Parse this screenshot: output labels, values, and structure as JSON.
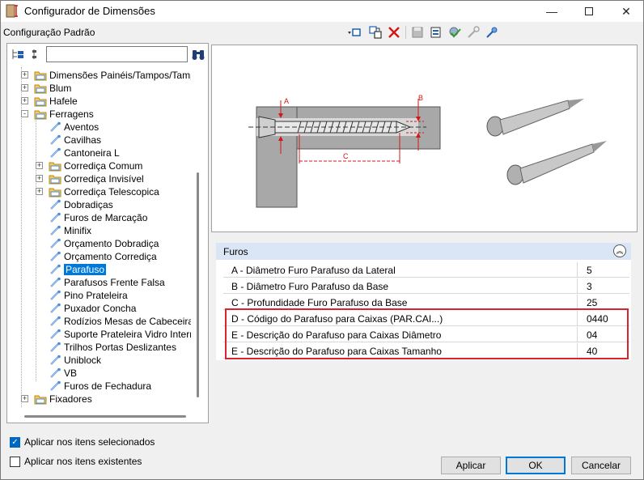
{
  "window": {
    "title": "Configurador de Dimensões"
  },
  "config_label": "Configuração Padrão",
  "toolbar_icons": [
    "fit-window-icon",
    "copy-icon",
    "delete-icon",
    "save-icon",
    "export-icon",
    "check-gear-icon",
    "link-icon",
    "pin-icon"
  ],
  "search": {
    "value": "",
    "placeholder": ""
  },
  "tree": [
    {
      "label": "Dimensões Painéis/Tampos/Tamponamentos",
      "level": 1,
      "type": "folder",
      "expander": "+"
    },
    {
      "label": "Blum",
      "level": 1,
      "type": "folder",
      "expander": "+"
    },
    {
      "label": "Hafele",
      "level": 1,
      "type": "folder",
      "expander": "+"
    },
    {
      "label": "Ferragens",
      "level": 1,
      "type": "folder",
      "expander": "-"
    },
    {
      "label": "Aventos",
      "level": 2,
      "type": "item"
    },
    {
      "label": "Cavilhas",
      "level": 2,
      "type": "item"
    },
    {
      "label": "Cantoneira L",
      "level": 2,
      "type": "item"
    },
    {
      "label": "Corrediça Comum",
      "level": 2,
      "type": "folder",
      "expander": "+"
    },
    {
      "label": "Corrediça Invisível",
      "level": 2,
      "type": "folder",
      "expander": "+"
    },
    {
      "label": "Corrediça Telescopica",
      "level": 2,
      "type": "folder",
      "expander": "+"
    },
    {
      "label": "Dobradiças",
      "level": 2,
      "type": "item"
    },
    {
      "label": "Furos de Marcação",
      "level": 2,
      "type": "item"
    },
    {
      "label": "Minifix",
      "level": 2,
      "type": "item"
    },
    {
      "label": "Orçamento Dobradiça",
      "level": 2,
      "type": "item"
    },
    {
      "label": "Orçamento Corrediça",
      "level": 2,
      "type": "item"
    },
    {
      "label": "Parafuso",
      "level": 2,
      "type": "item",
      "selected": true
    },
    {
      "label": "Parafusos Frente Falsa",
      "level": 2,
      "type": "item"
    },
    {
      "label": "Pino Prateleira",
      "level": 2,
      "type": "item"
    },
    {
      "label": "Puxador Concha",
      "level": 2,
      "type": "item"
    },
    {
      "label": "Rodízios Mesas de Cabeceira",
      "level": 2,
      "type": "item"
    },
    {
      "label": "Suporte Prateleira Vidro Interno",
      "level": 2,
      "type": "item"
    },
    {
      "label": "Trilhos Portas Deslizantes",
      "level": 2,
      "type": "item"
    },
    {
      "label": "Uniblock",
      "level": 2,
      "type": "item"
    },
    {
      "label": "VB",
      "level": 2,
      "type": "item"
    },
    {
      "label": "Furos de Fechadura",
      "level": 2,
      "type": "item"
    },
    {
      "label": "Fixadores",
      "level": 1,
      "type": "folder",
      "expander": "+"
    }
  ],
  "diagram": {
    "label_a": "A",
    "label_b": "B",
    "label_c": "C"
  },
  "grid": {
    "section_title": "Furos",
    "rows": [
      {
        "prop": "A - Diâmetro Furo Parafuso da Lateral",
        "value": "5"
      },
      {
        "prop": "B - Diâmetro Furo Parafuso da Base",
        "value": "3"
      },
      {
        "prop": "C - Profundidade Furo Parafuso da Base",
        "value": "25"
      },
      {
        "prop": "D - Código do Parafuso para Caixas (PAR.CAI...)",
        "value": "0440"
      },
      {
        "prop": "E - Descrição do Parafuso para Caixas Diâmetro",
        "value": "04"
      },
      {
        "prop": "E - Descrição do Parafuso para Caixas Tamanho",
        "value": "40"
      }
    ]
  },
  "options": {
    "apply_selected": {
      "label": "Aplicar nos itens selecionados",
      "checked": true
    },
    "apply_existing": {
      "label": "Aplicar nos itens existentes",
      "checked": false
    }
  },
  "buttons": {
    "apply": "Aplicar",
    "ok": "OK",
    "cancel": "Cancelar"
  },
  "colors": {
    "accent": "#0078d7",
    "highlight_frame": "#d9242f",
    "grid_header": "#dae6f5"
  }
}
